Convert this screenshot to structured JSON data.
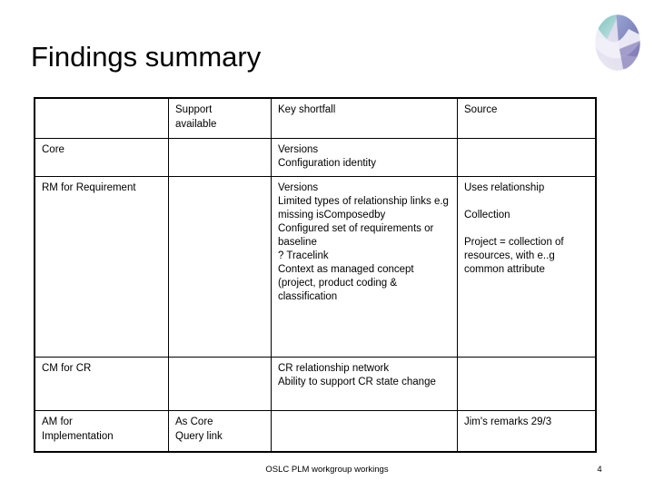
{
  "slide": {
    "title": "Findings summary",
    "logo_icon": "oslc-ellipse-logo",
    "footer": "OSLC PLM workgroup workings",
    "page_number": "4"
  },
  "colors": {
    "text": "#000000",
    "border": "#000000",
    "background": "#ffffff",
    "logo_teal": "#5aa9a0",
    "logo_purple": "#6a6aa8",
    "logo_blue": "#8f9fd0",
    "logo_salmon": "#d6a08a",
    "logo_pale": "#e8e6f2"
  },
  "table": {
    "headers": [
      "",
      "Support available",
      "Key shortfall",
      "Source"
    ],
    "header_cells": {
      "area": "",
      "support": [
        "Support",
        "available"
      ],
      "key_shortfall": [
        "Key shortfall"
      ],
      "source": [
        "Source"
      ]
    },
    "rows": [
      {
        "area": [
          "Core"
        ],
        "support": [],
        "key_shortfall": [
          "Versions",
          "Configuration identity"
        ],
        "source": []
      },
      {
        "area": [
          "RM for Requirement"
        ],
        "support": [],
        "key_shortfall": [
          "Versions",
          "Limited types of relationship links e.g missing isComposedby",
          "Configured set of requirements or baseline",
          "? Tracelink",
          "Context as managed concept (project, product coding & classification"
        ],
        "source": [
          "Uses relationship",
          "",
          "Collection",
          "",
          "Project = collection of resources, with e..g common attribute"
        ]
      },
      {
        "area": [
          "CM for CR"
        ],
        "support": [],
        "key_shortfall": [
          "CR relationship network",
          "Ability to support CR state change"
        ],
        "source": []
      },
      {
        "area": [
          "AM for",
          "Implementation"
        ],
        "support": [
          "As Core",
          "Query link"
        ],
        "key_shortfall": [],
        "source": [
          "Jim's remarks 29/3"
        ]
      }
    ]
  }
}
